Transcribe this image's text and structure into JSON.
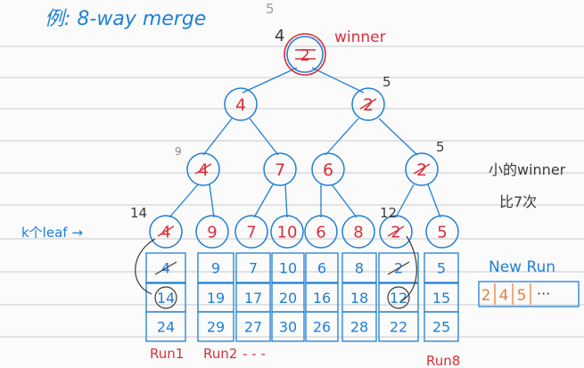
{
  "heading": "例: 8-way merge",
  "top_node": {
    "crossed": "2",
    "label": "winner",
    "over": "5",
    "side": "4"
  },
  "level1": [
    {
      "value": "4",
      "crossed": false
    },
    {
      "value": "2",
      "crossed": true,
      "over": "5"
    }
  ],
  "level2": [
    {
      "value": "4",
      "crossed": true,
      "side": "9"
    },
    {
      "value": "7",
      "crossed": false
    },
    {
      "value": "6",
      "crossed": false
    },
    {
      "value": "2",
      "crossed": true,
      "over": "5"
    }
  ],
  "leaves": [
    {
      "value": "4",
      "crossed": true,
      "over": "14"
    },
    {
      "value": "9",
      "crossed": false
    },
    {
      "value": "7",
      "crossed": false
    },
    {
      "value": "10",
      "crossed": false
    },
    {
      "value": "6",
      "crossed": false
    },
    {
      "value": "8",
      "crossed": false
    },
    {
      "value": "2",
      "crossed": true,
      "over": "12"
    },
    {
      "value": "5",
      "crossed": false
    }
  ],
  "leaf_label": "k个leaf →",
  "runs": [
    [
      "4",
      "14",
      "24"
    ],
    [
      "9",
      "19",
      "29"
    ],
    [
      "7",
      "17",
      "27"
    ],
    [
      "10",
      "20",
      "30"
    ],
    [
      "6",
      "16",
      "26"
    ],
    [
      "8",
      "18",
      "28"
    ],
    [
      "2",
      "12",
      "22"
    ],
    [
      "5",
      "15",
      "25"
    ]
  ],
  "run_labels": {
    "run1": "Run1",
    "run2": "Run2",
    "dots": "- - -",
    "run8": "Run8"
  },
  "side_note": {
    "line1": "小的winner",
    "line2": "比7次"
  },
  "new_run": {
    "title": "New Run",
    "values": [
      "2",
      "4",
      "5"
    ],
    "more": "···"
  },
  "colors": {
    "ink_blue": "#1f7fd6",
    "ink_red": "#d8303a",
    "ink_orange": "#e8803a",
    "ink_dark": "#3a3a3a",
    "rule_line": "#c9c9c9"
  }
}
